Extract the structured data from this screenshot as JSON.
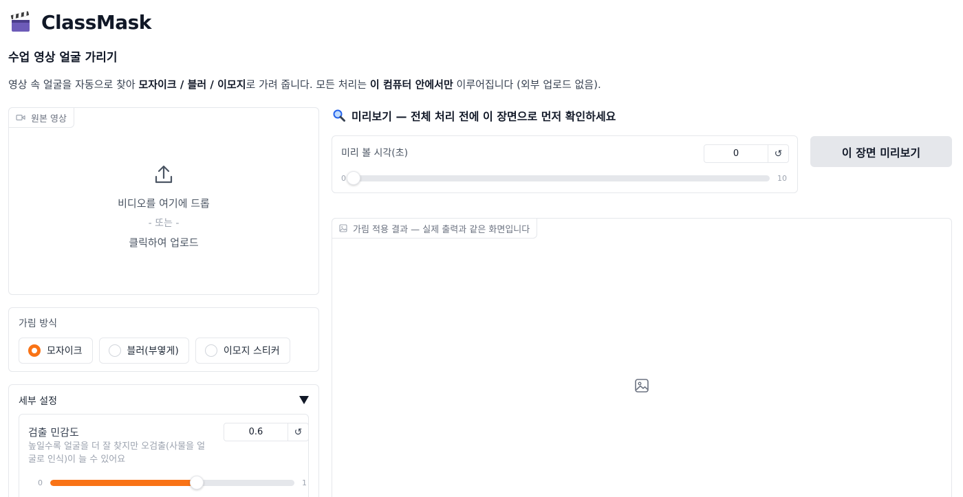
{
  "app": {
    "title": "ClassMask",
    "icon": "clapperboard-icon",
    "subtitle": "수업 영상 얼굴 가리기",
    "description": {
      "p1": "영상 속 얼굴을 자동으로 찾아 ",
      "b1": "모자이크 / 블러 / 이모지",
      "p2": "로 가려 줍니다. 모든 처리는 ",
      "b2": "이 컴퓨터 안에서만",
      "p3": " 이루어집니다 (외부 업로드 없음)."
    }
  },
  "upload": {
    "tag": "원본 영상",
    "tag_icon": "video-icon",
    "icon": "upload-icon",
    "line1": "비디오를 여기에 드롭",
    "or": "- 또는 -",
    "line2": "클릭하여 업로드"
  },
  "mode": {
    "label": "가림 방식",
    "options": [
      "모자이크",
      "블러(부옇게)",
      "이모지 스티커"
    ],
    "selected": "모자이크"
  },
  "advanced": {
    "title": "세부 설정",
    "expanded": true,
    "sensitivity": {
      "label": "검출 민감도",
      "info": "높일수록 얼굴을 더 잘 찾지만 오검출(사물을 얼굴로 인식)이 늘 수 있어요",
      "value": "0.6",
      "min": "0",
      "max": "1",
      "fraction": 0.6
    }
  },
  "preview": {
    "heading_icon": "magnifier-icon",
    "heading": "미리보기 — 전체 처리 전에 이 장면으로 먼저 확인하세요",
    "time_label": "미리 볼 시각(초)",
    "time_value": "0",
    "time_min": "0",
    "time_max": "10",
    "time_fraction": 0,
    "button": "이 장면 미리보기"
  },
  "result": {
    "tag": "가림 적용 결과 — 실제 출력과 같은 화면입니다",
    "tag_icon": "image-icon",
    "placeholder_icon": "image-icon"
  },
  "colors": {
    "accent": "#f97316",
    "button_bg": "#e5e7eb",
    "border": "#e5e7eb"
  },
  "icons": {
    "reset": "↺"
  }
}
